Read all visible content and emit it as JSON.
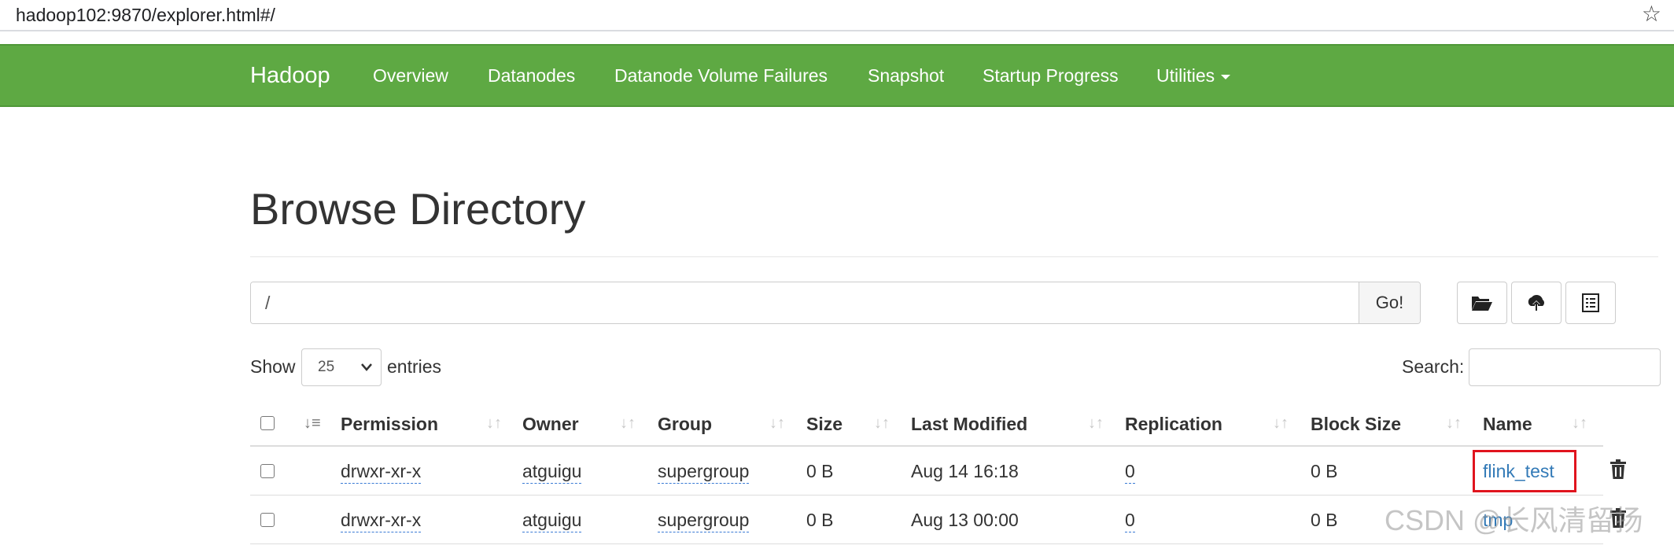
{
  "browser": {
    "url": "hadoop102:9870/explorer.html#/"
  },
  "navbar": {
    "brand": "Hadoop",
    "links": [
      "Overview",
      "Datanodes",
      "Datanode Volume Failures",
      "Snapshot",
      "Startup Progress",
      "Utilities"
    ]
  },
  "page": {
    "title": "Browse Directory"
  },
  "path": {
    "value": "/",
    "go_label": "Go!"
  },
  "toolbar": {
    "icons": [
      "folder-open-icon",
      "upload-cloud-icon",
      "list-icon"
    ]
  },
  "listing": {
    "show_label": "Show",
    "entries_value": "25",
    "entries_label": "entries",
    "search_label": "Search:"
  },
  "table": {
    "columns": [
      "Permission",
      "Owner",
      "Group",
      "Size",
      "Last Modified",
      "Replication",
      "Block Size",
      "Name"
    ],
    "rows": [
      {
        "permission": "drwxr-xr-x",
        "owner": "atguigu",
        "group": "supergroup",
        "size": "0 B",
        "modified": "Aug 14 16:18",
        "replication": "0",
        "block_size": "0 B",
        "name": "flink_test"
      },
      {
        "permission": "drwxr-xr-x",
        "owner": "atguigu",
        "group": "supergroup",
        "size": "0 B",
        "modified": "Aug 13 00:00",
        "replication": "0",
        "block_size": "0 B",
        "name": "tmp"
      }
    ]
  },
  "watermark": "CSDN @长风清留扬",
  "colors": {
    "navbar": "#5ea943",
    "highlight": "#e0141e",
    "link": "#337ab7"
  }
}
